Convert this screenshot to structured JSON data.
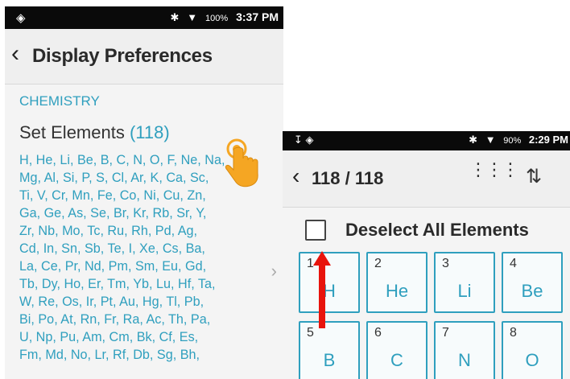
{
  "left": {
    "status": {
      "carrier_icon": "android-icon",
      "battery": "100%",
      "time": "3:37 PM"
    },
    "title": "Display Preferences",
    "section": "CHEMISTRY",
    "set_elements_label": "Set Elements",
    "set_elements_count": "(118)",
    "element_lines": [
      "H, He, Li, Be, B, C, N, O, F, Ne, Na,",
      "Mg, Al, Si, P, S, Cl, Ar, K, Ca, Sc,",
      "Ti, V, Cr, Mn, Fe, Co, Ni, Cu, Zn,",
      "Ga, Ge, As, Se, Br, Kr, Rb, Sr, Y,",
      "Zr, Nb, Mo, Tc, Ru, Rh, Pd, Ag,",
      "Cd, In, Sn, Sb, Te, I, Xe, Cs, Ba,",
      "La, Ce, Pr, Nd, Pm, Sm, Eu, Gd,",
      "Tb, Dy, Ho, Er, Tm, Yb, Lu, Hf, Ta,",
      "W, Re, Os, Ir, Pt, Au, Hg, Tl, Pb,",
      "Bi, Po, At, Rn, Fr, Ra, Ac, Th, Pa,",
      "U, Np, Pu, Am, Cm, Bk, Cf, Es,",
      "Fm, Md, No, Lr, Rf, Db, Sg, Bh,"
    ]
  },
  "right": {
    "status": {
      "battery": "90%",
      "time": "2:29 PM"
    },
    "count": "118 / 118",
    "deselect_label": "Deselect All Elements",
    "tiles": [
      {
        "num": "1",
        "sym": "H"
      },
      {
        "num": "2",
        "sym": "He"
      },
      {
        "num": "3",
        "sym": "Li"
      },
      {
        "num": "4",
        "sym": "Be"
      },
      {
        "num": "5",
        "sym": "B"
      },
      {
        "num": "6",
        "sym": "C"
      },
      {
        "num": "7",
        "sym": "N"
      },
      {
        "num": "8",
        "sym": "O"
      }
    ]
  },
  "colors": {
    "accent": "#2f9fbe",
    "arrow": "#e8140c",
    "hand": "#f5a623"
  },
  "icons": [
    "back-chevron-icon",
    "bluetooth-icon",
    "wifi-icon",
    "grid-icon",
    "sort-icon",
    "tap-hand-icon",
    "up-arrow-icon"
  ]
}
